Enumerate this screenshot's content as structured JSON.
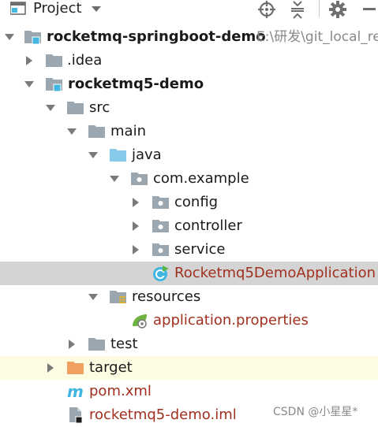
{
  "header": {
    "title": "Project",
    "icons": {
      "project": "project-folder-icon",
      "dropdown": "chevron-down-icon",
      "target": "crosshair-icon",
      "collapse": "collapse-all-icon",
      "settings": "gear-icon",
      "minimize": "minimize-icon"
    }
  },
  "tree": {
    "root": {
      "label": "rocketmq-springboot-demo",
      "path": "E:\\研发\\git_local_re"
    },
    "idea": {
      "label": ".idea"
    },
    "module": {
      "label": "rocketmq5-demo"
    },
    "src": {
      "label": "src"
    },
    "main": {
      "label": "main"
    },
    "java": {
      "label": "java"
    },
    "package": {
      "label": "com.example"
    },
    "config": {
      "label": "config"
    },
    "controller": {
      "label": "controller"
    },
    "service": {
      "label": "service"
    },
    "app_class": {
      "label": "Rocketmq5DemoApplication"
    },
    "resources": {
      "label": "resources"
    },
    "app_props": {
      "label": "application.properties"
    },
    "test": {
      "label": "test"
    },
    "target": {
      "label": "target"
    },
    "pom": {
      "label": "pom.xml"
    },
    "iml": {
      "label": "rocketmq5-demo.iml"
    }
  },
  "watermark": "CSDN @小星星*",
  "colors": {
    "folder_gray": "#9aa7b0",
    "folder_blue": "#87c9ea",
    "folder_orange": "#f0a060",
    "module_blue": "#40b6e0",
    "selected_row": "#d4d4d4",
    "highlight_row": "#fdfbe2",
    "modified_text": "#a0301f"
  }
}
